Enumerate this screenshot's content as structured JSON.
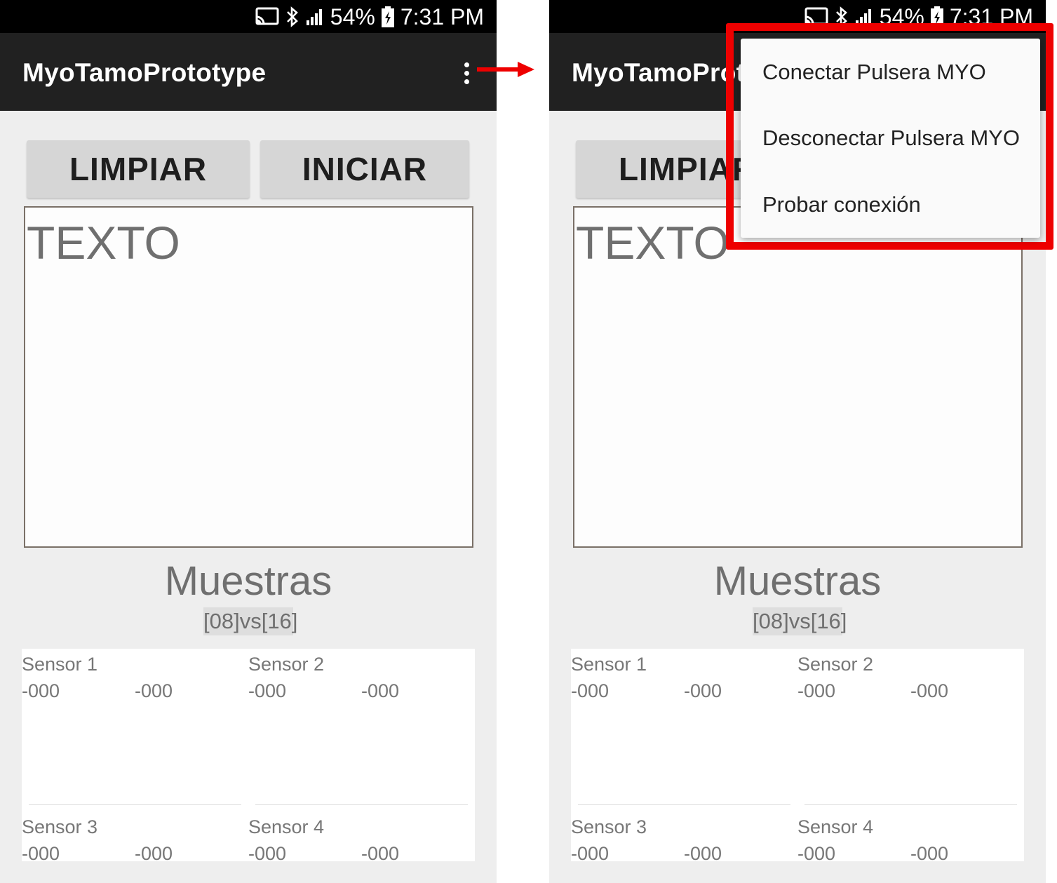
{
  "status_bar": {
    "battery": "54%",
    "time": "7:31 PM",
    "icons": [
      "cast-icon",
      "bluetooth-icon",
      "signal-icon",
      "battery-charging-icon"
    ]
  },
  "app": {
    "title": "MyoTamoPrototype"
  },
  "buttons": {
    "clear": "LIMPIAR",
    "start": "INICIAR"
  },
  "text_area": {
    "placeholder": "TEXTO"
  },
  "samples": {
    "title": "Muestras",
    "ratio": "[08]vs[16]"
  },
  "sensors": [
    {
      "name": "Sensor 1",
      "value_a": "-000",
      "value_b": "-000"
    },
    {
      "name": "Sensor 2",
      "value_a": "-000",
      "value_b": "-000"
    },
    {
      "name": "Sensor 3",
      "value_a": "-000",
      "value_b": "-000"
    },
    {
      "name": "Sensor 4",
      "value_a": "-000",
      "value_b": "-000"
    }
  ],
  "overflow_menu": {
    "items": [
      "Conectar Pulsera MYO",
      "Desconectar Pulsera MYO",
      "Probar conexión"
    ]
  },
  "colors": {
    "app_bar": "#212121",
    "status_bar": "#000000",
    "screen_bg": "#eeeeee",
    "button_bg": "#d6d6d6",
    "highlight": "#ee0000"
  }
}
